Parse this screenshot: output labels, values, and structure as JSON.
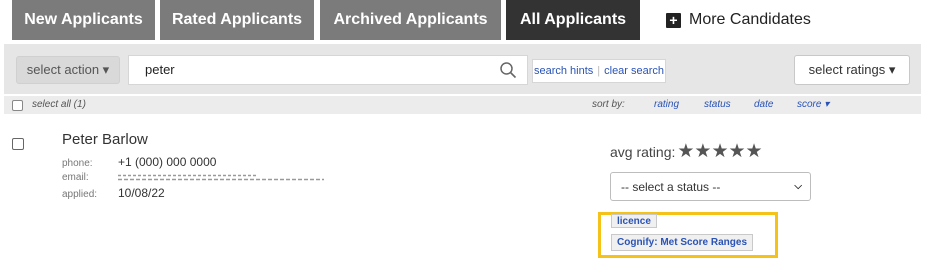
{
  "tabs": [
    {
      "label": "New Applicants"
    },
    {
      "label": "Rated Applicants"
    },
    {
      "label": "Archived Applicants"
    },
    {
      "label": "All Applicants"
    }
  ],
  "more_candidates_label": "More Candidates",
  "toolbar": {
    "action_label": "select action ▾",
    "search_value": "peter",
    "search_hints": "search hints",
    "clear_search": "clear search",
    "ratings_label": "select ratings ▾"
  },
  "sortbar": {
    "select_all": "select all (1)",
    "sort_by": "sort by:",
    "rating": "rating",
    "status": "status",
    "date": "date",
    "score": "score ▾"
  },
  "applicant": {
    "name": "Peter Barlow",
    "phone_label": "phone:",
    "phone": "+1 (000) 000 0000",
    "email_label": "email:",
    "applied_label": "applied:",
    "applied": "10/08/22",
    "avg_rating_label": "avg rating:",
    "stars": "★★★★★",
    "status_select": "-- select a status --",
    "tags": [
      "licence",
      "Cognify: Met Score Ranges"
    ]
  },
  "colors": {
    "tab": "#7b7b7b",
    "tab_active": "#333333",
    "link": "#2a53b5",
    "highlight": "#f5c21a"
  }
}
